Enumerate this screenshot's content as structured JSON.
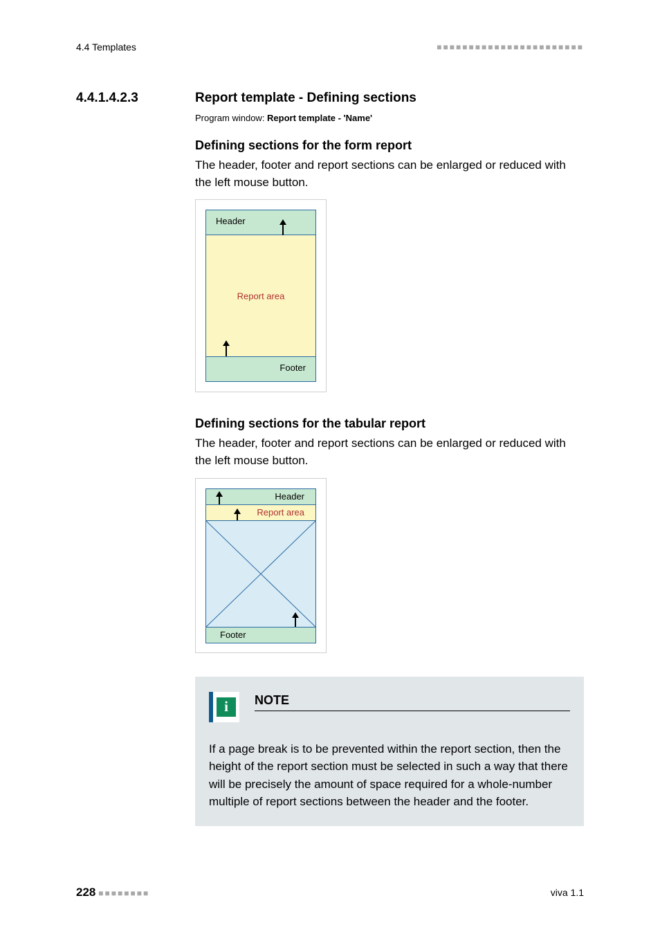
{
  "header": {
    "left": "4.4 Templates"
  },
  "section": {
    "number": "4.4.1.4.2.3",
    "title": "Report template - Defining sections",
    "progWinLabel": "Program window: ",
    "progWinValue": "Report template - 'Name'"
  },
  "formReport": {
    "heading": "Defining sections for the form report",
    "desc": "The header, footer and report sections can be enlarged or reduced with the left mouse button.",
    "labels": {
      "header": "Header",
      "area": "Report area",
      "footer": "Footer"
    }
  },
  "tabReport": {
    "heading": "Defining sections for the tabular report",
    "desc": "The header, footer and report sections can be enlarged or reduced with the left mouse button.",
    "labels": {
      "header": "Header",
      "area": "Report area",
      "footer": "Footer"
    }
  },
  "note": {
    "title": "NOTE",
    "body": "If a page break is to be prevented within the report section, then the height of the report section must be selected in such a way that there will be precisely the amount of space required for a whole-number multiple of report sections between the header and the footer."
  },
  "footer": {
    "pageNum": "228",
    "right": "viva 1.1"
  }
}
